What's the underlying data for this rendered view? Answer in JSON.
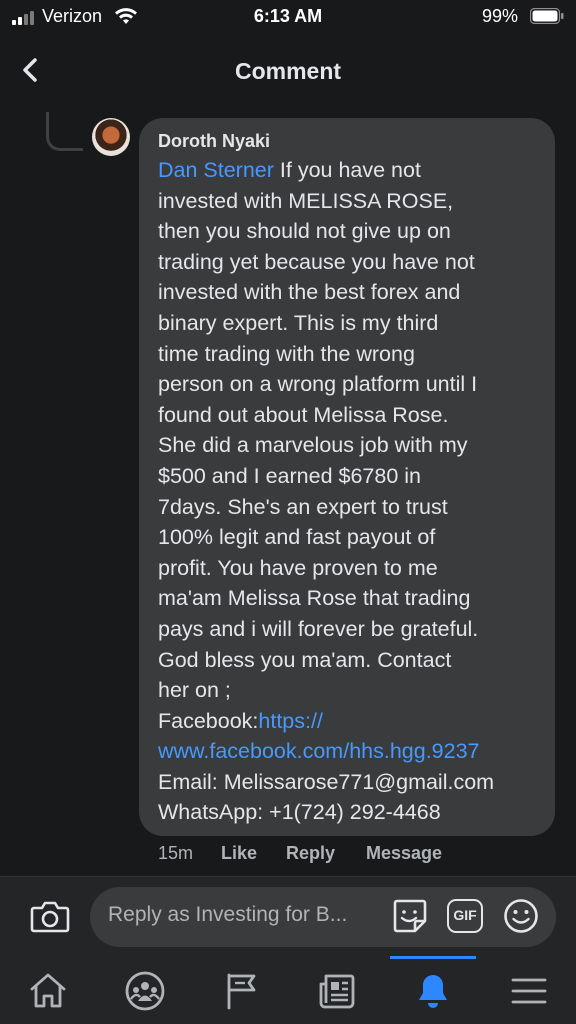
{
  "status_bar": {
    "carrier": "Verizon",
    "time": "6:13 AM",
    "battery": "99%"
  },
  "header": {
    "title": "Comment"
  },
  "comment": {
    "author": "Doroth Nyaki",
    "mention": "Dan Sterner",
    "lines": [
      " If you have not",
      "invested with MELISSA ROSE,",
      "then you should not give up on",
      "trading yet because you have not",
      "invested with the best forex and",
      "binary expert. This is my third",
      "time trading with the wrong",
      "person on a wrong platform until I",
      "found out about Melissa Rose.",
      "She did a marvelous job with my",
      "$500 and I earned $6780 in",
      "7days. She's an expert to trust",
      "100% legit and fast payout of",
      "profit. You have proven to me",
      "ma'am Melissa Rose that trading",
      "pays and i will forever be grateful.",
      "God bless you ma'am. Contact",
      "her on ;"
    ],
    "facebook_label": "Facebook:",
    "facebook_link_1": "https://",
    "facebook_link_2": "www.facebook.com/hhs.hgg.9237",
    "email": "Email: Melissarose771@gmail.com",
    "whatsapp": "WhatsApp: +1(724) 292-4468"
  },
  "actions": {
    "time": "15m",
    "like": "Like",
    "reply": "Reply",
    "message": "Message"
  },
  "reply_bar": {
    "placeholder": "Reply as Investing for B...",
    "gif_label": "GIF"
  },
  "tab_bar": {
    "active": "notifications",
    "active_color": "#2d88ff",
    "icons": [
      "home-icon",
      "groups-icon",
      "pages-flag-icon",
      "news-feed-icon",
      "notifications-bell-icon",
      "menu-icon"
    ]
  },
  "colors": {
    "background": "#18191a",
    "bubble": "#3a3b3c",
    "link": "#4599ff",
    "text": "#e4e6eb",
    "muted": "#b0b3b8"
  }
}
